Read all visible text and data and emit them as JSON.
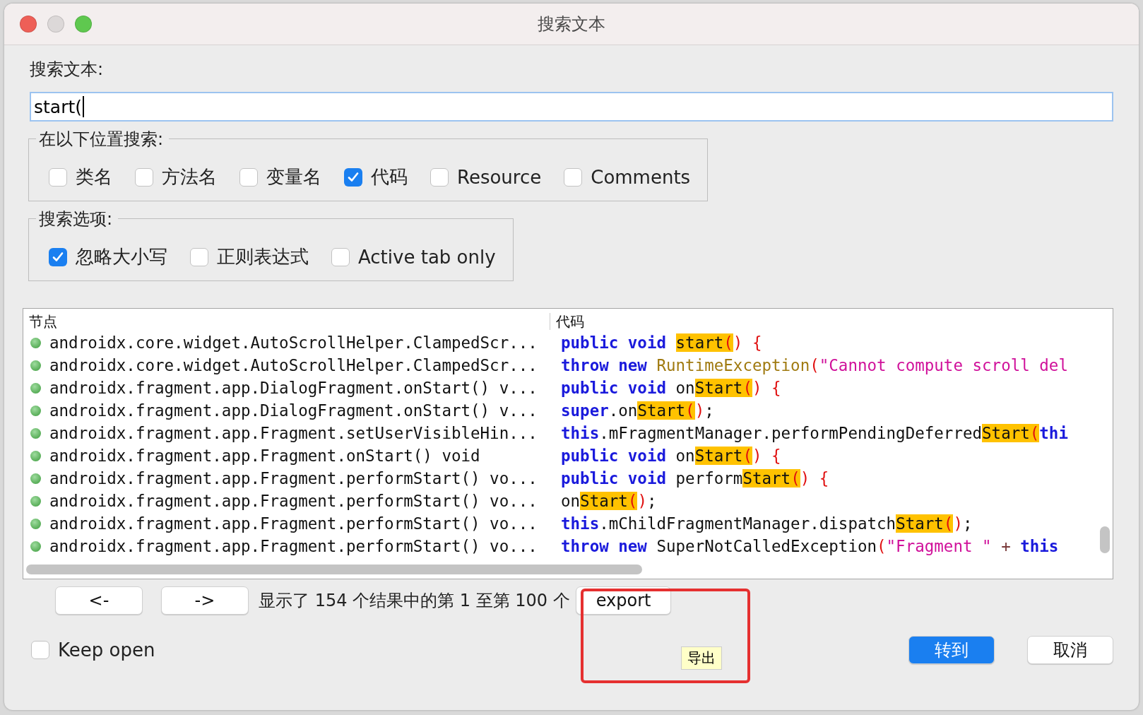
{
  "window": {
    "title": "搜索文本"
  },
  "search": {
    "label": "搜索文本:",
    "value": "start("
  },
  "scope": {
    "title": "在以下位置搜索:",
    "options": [
      {
        "label": "类名",
        "checked": false
      },
      {
        "label": "方法名",
        "checked": false
      },
      {
        "label": "变量名",
        "checked": false
      },
      {
        "label": "代码",
        "checked": true
      },
      {
        "label": "Resource",
        "checked": false
      },
      {
        "label": "Comments",
        "checked": false
      }
    ]
  },
  "options": {
    "title": "搜索选项:",
    "options": [
      {
        "label": "忽略大小写",
        "checked": true
      },
      {
        "label": "正则表达式",
        "checked": false
      },
      {
        "label": "Active tab only",
        "checked": false
      }
    ]
  },
  "table": {
    "columns": [
      "节点",
      "代码"
    ],
    "rows": [
      {
        "node": "androidx.core.widget.AutoScrollHelper.ClampedScr...",
        "code": [
          {
            "text": "public void ",
            "kind": "keyword",
            "match": false
          },
          {
            "text": "start",
            "kind": "plain",
            "match": true
          },
          {
            "text": "(",
            "kind": "punct",
            "match": true
          },
          {
            "text": ") {",
            "kind": "punct",
            "match": false
          }
        ]
      },
      {
        "node": "androidx.core.widget.AutoScrollHelper.ClampedScr...",
        "code": [
          {
            "text": "throw new ",
            "kind": "keyword",
            "match": false
          },
          {
            "text": "RuntimeException",
            "kind": "type",
            "match": false
          },
          {
            "text": "(",
            "kind": "punct",
            "match": false
          },
          {
            "text": "\"Cannot compute scroll del",
            "kind": "string",
            "match": false
          }
        ]
      },
      {
        "node": "androidx.fragment.app.DialogFragment.onStart() v...",
        "code": [
          {
            "text": "public void ",
            "kind": "keyword",
            "match": false
          },
          {
            "text": "on",
            "kind": "plain",
            "match": false
          },
          {
            "text": "Start",
            "kind": "plain",
            "match": true
          },
          {
            "text": "(",
            "kind": "punct",
            "match": true
          },
          {
            "text": ") {",
            "kind": "punct",
            "match": false
          }
        ]
      },
      {
        "node": "androidx.fragment.app.DialogFragment.onStart() v...",
        "code": [
          {
            "text": "super",
            "kind": "keyword",
            "match": false
          },
          {
            "text": ".on",
            "kind": "plain",
            "match": false
          },
          {
            "text": "Start",
            "kind": "plain",
            "match": true
          },
          {
            "text": "(",
            "kind": "punct",
            "match": true
          },
          {
            "text": ")",
            "kind": "punct",
            "match": false
          },
          {
            "text": ";",
            "kind": "plain",
            "match": false
          }
        ]
      },
      {
        "node": "androidx.fragment.app.Fragment.setUserVisibleHin...",
        "code": [
          {
            "text": "this",
            "kind": "keyword",
            "match": false
          },
          {
            "text": ".mFragmentManager.performPendingDeferred",
            "kind": "plain",
            "match": false
          },
          {
            "text": "Start",
            "kind": "plain",
            "match": true
          },
          {
            "text": "(",
            "kind": "punct",
            "match": true
          },
          {
            "text": "thi",
            "kind": "keyword",
            "match": false
          }
        ]
      },
      {
        "node": "androidx.fragment.app.Fragment.onStart() void",
        "code": [
          {
            "text": "public void ",
            "kind": "keyword",
            "match": false
          },
          {
            "text": "on",
            "kind": "plain",
            "match": false
          },
          {
            "text": "Start",
            "kind": "plain",
            "match": true
          },
          {
            "text": "(",
            "kind": "punct",
            "match": true
          },
          {
            "text": ") {",
            "kind": "punct",
            "match": false
          }
        ]
      },
      {
        "node": "androidx.fragment.app.Fragment.performStart() vo...",
        "code": [
          {
            "text": "public void ",
            "kind": "keyword",
            "match": false
          },
          {
            "text": "perform",
            "kind": "plain",
            "match": false
          },
          {
            "text": "Start",
            "kind": "plain",
            "match": true
          },
          {
            "text": "(",
            "kind": "punct",
            "match": true
          },
          {
            "text": ") {",
            "kind": "punct",
            "match": false
          }
        ]
      },
      {
        "node": "androidx.fragment.app.Fragment.performStart() vo...",
        "code": [
          {
            "text": "on",
            "kind": "plain",
            "match": false
          },
          {
            "text": "Start",
            "kind": "plain",
            "match": true
          },
          {
            "text": "(",
            "kind": "punct",
            "match": true
          },
          {
            "text": ")",
            "kind": "punct",
            "match": false
          },
          {
            "text": ";",
            "kind": "plain",
            "match": false
          }
        ]
      },
      {
        "node": "androidx.fragment.app.Fragment.performStart() vo...",
        "code": [
          {
            "text": "this",
            "kind": "keyword",
            "match": false
          },
          {
            "text": ".mChildFragmentManager.dispatch",
            "kind": "plain",
            "match": false
          },
          {
            "text": "Start",
            "kind": "plain",
            "match": true
          },
          {
            "text": "(",
            "kind": "punct",
            "match": true
          },
          {
            "text": ")",
            "kind": "punct",
            "match": false
          },
          {
            "text": ";",
            "kind": "plain",
            "match": false
          }
        ]
      },
      {
        "node": "androidx.fragment.app.Fragment.performStart() vo...",
        "code": [
          {
            "text": "throw new ",
            "kind": "keyword",
            "match": false
          },
          {
            "text": "SuperNotCalledException",
            "kind": "plain",
            "match": false
          },
          {
            "text": "(",
            "kind": "punct",
            "match": false
          },
          {
            "text": "\"Fragment \"",
            "kind": "string",
            "match": false
          },
          {
            "text": " + ",
            "kind": "operator",
            "match": false
          },
          {
            "text": "this",
            "kind": "keyword",
            "match": false
          }
        ]
      }
    ]
  },
  "pager": {
    "prev": "<-",
    "next": "->",
    "status": "显示了 154 个结果中的第 1 至第 100 个",
    "export": "export",
    "tooltip": "导出"
  },
  "keep_open": {
    "label": "Keep open",
    "checked": false
  },
  "buttons": [
    {
      "label": "转到",
      "kind": "primary"
    },
    {
      "label": "取消",
      "kind": "default"
    }
  ]
}
